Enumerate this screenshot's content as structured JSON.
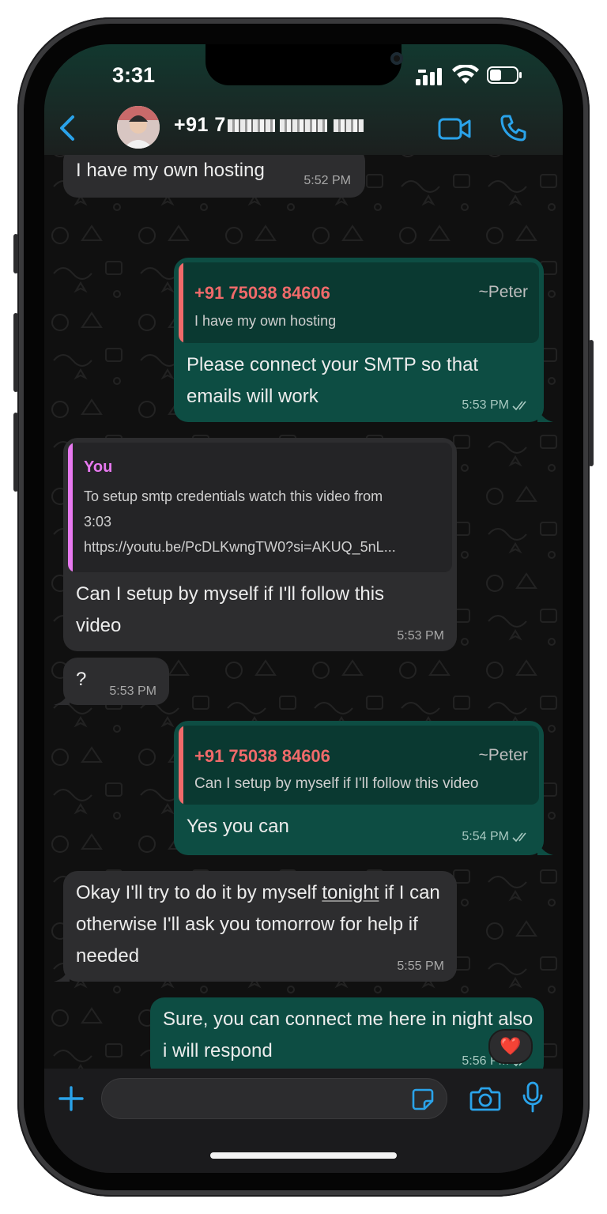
{
  "status_bar": {
    "time": "3:31"
  },
  "header": {
    "contact_name": "+91 7",
    "icons": {
      "back": "chevron-left-icon",
      "video": "video-call-icon",
      "call": "phone-icon"
    },
    "accent_color": "#2aa3ea"
  },
  "colors": {
    "incoming_bubble": "#2d2d2f",
    "outgoing_bubble": "#0d4d43",
    "quote_author_peter": "#f06a6a",
    "quote_author_you": "#e879f0",
    "reaction_heart": "#e45b6f"
  },
  "messages": [
    {
      "dir": "in",
      "text": "I have my own hosting",
      "time": "5:52 PM"
    },
    {
      "dir": "out",
      "quote": {
        "author": "+91 75038 84606",
        "tag": "~Peter",
        "text": "I have my own hosting"
      },
      "text": "Please connect your SMTP so that emails will work",
      "time": "5:53 PM"
    },
    {
      "dir": "in",
      "quote": {
        "author": "You",
        "line1": "To setup smtp credentials watch this video from",
        "line2": "3:03",
        "line3": "https://youtu.be/PcDLKwngTW0?si=AKUQ_5nL..."
      },
      "text": "Can I setup by myself if I'll follow this video",
      "time": "5:53 PM"
    },
    {
      "dir": "in",
      "text": "?",
      "time": "5:53 PM"
    },
    {
      "dir": "out",
      "quote": {
        "author": "+91 75038 84606",
        "tag": "~Peter",
        "text": "Can I setup by myself if I'll follow this video"
      },
      "text": "Yes you can",
      "time": "5:54 PM"
    },
    {
      "dir": "in",
      "text_parts": {
        "before": "Okay I'll try to do it by myself ",
        "link": "tonight",
        "after": " if I can otherwise I'll ask you tomorrow for help if needed"
      },
      "time": "5:55 PM"
    },
    {
      "dir": "out",
      "text": "Sure, you can connect me here in night also i will respond",
      "time": "5:56 PM",
      "reaction": "❤️"
    }
  ],
  "input": {
    "placeholder": "",
    "value": ""
  }
}
